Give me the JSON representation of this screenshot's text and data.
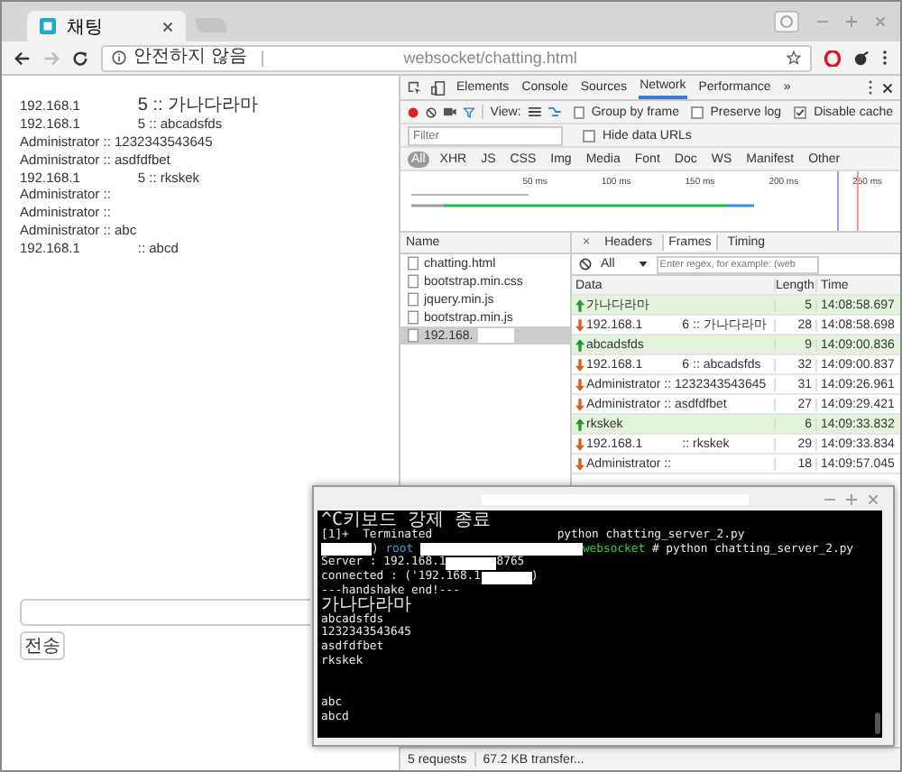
{
  "browser": {
    "tab": {
      "title": "채팅"
    },
    "address": {
      "security": "안전하지 않음",
      "url": "websocket/chatting.html"
    }
  },
  "chat": {
    "messages": [
      {
        "parts": [
          "192.168.1",
          "5 :: 가나다라마"
        ]
      },
      {
        "parts": [
          "192.168.1",
          "5 :: abcadsfds"
        ]
      },
      {
        "parts": [
          "Administrator :: 1232343543645"
        ]
      },
      {
        "parts": [
          "Administrator :: asdfdfbet"
        ]
      },
      {
        "parts": [
          "192.168.1",
          "5 :: rkskek"
        ]
      },
      {
        "parts": [
          "Administrator ::"
        ]
      },
      {
        "parts": [
          "Administrator ::"
        ]
      },
      {
        "parts": [
          "Administrator :: abc"
        ]
      },
      {
        "parts": [
          "192.168.1",
          ":: abcd"
        ]
      }
    ],
    "send_button": "전송"
  },
  "devtools": {
    "tabs": [
      {
        "label": "Elements",
        "selected": false
      },
      {
        "label": "Console",
        "selected": false
      },
      {
        "label": "Sources",
        "selected": false
      },
      {
        "label": "Network",
        "selected": true
      },
      {
        "label": "Performance",
        "selected": false
      }
    ],
    "more": "»",
    "view_label": "View:",
    "options": [
      {
        "label": "Group by frame",
        "checked": false
      },
      {
        "label": "Preserve log",
        "checked": false
      },
      {
        "label": "Disable cache",
        "checked": true
      }
    ],
    "filter": {
      "placeholder": "Filter"
    },
    "hide_data_urls": {
      "label": "Hide data URLs",
      "checked": false
    },
    "types": [
      {
        "label": "All",
        "selected": true
      },
      {
        "label": "XHR",
        "selected": false
      },
      {
        "label": "JS",
        "selected": false
      },
      {
        "label": "CSS",
        "selected": false
      },
      {
        "label": "Img",
        "selected": false
      },
      {
        "label": "Media",
        "selected": false
      },
      {
        "label": "Font",
        "selected": false
      },
      {
        "label": "Doc",
        "selected": false
      },
      {
        "label": "WS",
        "selected": false
      },
      {
        "label": "Manifest",
        "selected": false
      },
      {
        "label": "Other",
        "selected": false
      }
    ],
    "timeline_ticks": [
      "50 ms",
      "100 ms",
      "150 ms",
      "200 ms",
      "250 ms"
    ],
    "name_header": "Name",
    "requests": [
      {
        "name": "chatting.html",
        "selected": false
      },
      {
        "name": "bootstrap.min.css",
        "selected": false
      },
      {
        "name": "jquery.min.js",
        "selected": false
      },
      {
        "name": "bootstrap.min.js",
        "selected": false
      },
      {
        "name": "192.168.",
        "selected": true
      }
    ],
    "detail_close": "×",
    "detail_tabs": [
      {
        "label": "Headers",
        "selected": false
      },
      {
        "label": "Frames",
        "selected": true
      },
      {
        "label": "Timing",
        "selected": false
      }
    ],
    "frame_filter": {
      "value": "All",
      "placeholder": "Enter regex, for example: (web"
    },
    "columns": [
      "Data",
      "Length",
      "Time"
    ],
    "frames": [
      {
        "kind": "send",
        "parts": [
          "가나다라마"
        ],
        "length": "5",
        "time": "14:08:58.697"
      },
      {
        "kind": "receive",
        "parts": [
          "192.168.1",
          "6 :: 가나다라마"
        ],
        "length": "28",
        "time": "14:08:58.698"
      },
      {
        "kind": "send",
        "parts": [
          "abcadsfds"
        ],
        "length": "9",
        "time": "14:09:00.836"
      },
      {
        "kind": "receive",
        "parts": [
          "192.168.1",
          "6 :: abcadsfds"
        ],
        "length": "32",
        "time": "14:09:00.837"
      },
      {
        "kind": "receive",
        "parts": [
          "Administrator :: 1232343543645"
        ],
        "length": "31",
        "time": "14:09:26.961"
      },
      {
        "kind": "receive",
        "parts": [
          "Administrator :: asdfdfbet"
        ],
        "length": "27",
        "time": "14:09:29.421"
      },
      {
        "kind": "send",
        "parts": [
          "rkskek"
        ],
        "length": "6",
        "time": "14:09:33.832"
      },
      {
        "kind": "receive",
        "parts": [
          "192.168.1",
          ":: rkskek"
        ],
        "length": "29",
        "time": "14:09:33.834"
      },
      {
        "kind": "receive",
        "parts": [
          "Administrator ::"
        ],
        "length": "18",
        "time": "14:09:57.045"
      }
    ],
    "status": [
      "5 requests",
      "67.2 KB transfer..."
    ]
  },
  "terminal": {
    "lines": [
      {
        "kind": "output",
        "segments": [
          {
            "kind": "text",
            "text": "^C키보드 강제 종료"
          }
        ]
      },
      {
        "kind": "output",
        "segments": [
          {
            "kind": "text",
            "text": "[1]+  Terminated                  python chatting_server_2.py"
          }
        ]
      },
      {
        "kind": "output",
        "segments": [
          {
            "kind": "redacted"
          },
          {
            "kind": "text",
            "text": ")"
          },
          {
            "kind": "prompt",
            "text": " root "
          },
          {
            "kind": "redacted"
          },
          {
            "kind": "path",
            "text": "websocket"
          },
          {
            "kind": "text",
            "text": " # python chatting_server_2.py"
          }
        ]
      },
      {
        "kind": "output",
        "segments": [
          {
            "kind": "text",
            "text": "Server : 192.168.1"
          },
          {
            "kind": "redacted"
          },
          {
            "kind": "text",
            "text": "8765"
          }
        ]
      },
      {
        "kind": "output",
        "segments": [
          {
            "kind": "text",
            "text": "connected : ('192.168.1"
          },
          {
            "kind": "redacted"
          },
          {
            "kind": "text",
            "text": ")"
          }
        ]
      },
      {
        "kind": "output",
        "segments": [
          {
            "kind": "text",
            "text": "---handshake end!---"
          }
        ]
      },
      {
        "kind": "output",
        "segments": [
          {
            "kind": "text",
            "text": "가나다라마"
          }
        ]
      },
      {
        "kind": "output",
        "segments": [
          {
            "kind": "text",
            "text": "abcadsfds"
          }
        ]
      },
      {
        "kind": "output",
        "segments": [
          {
            "kind": "text",
            "text": "1232343543645"
          }
        ]
      },
      {
        "kind": "output",
        "segments": [
          {
            "kind": "text",
            "text": "asdfdfbet"
          }
        ]
      },
      {
        "kind": "output",
        "segments": [
          {
            "kind": "text",
            "text": "rkskek"
          }
        ]
      },
      {
        "kind": "blank"
      },
      {
        "kind": "blank"
      },
      {
        "kind": "output",
        "segments": [
          {
            "kind": "text",
            "text": "abc"
          }
        ]
      },
      {
        "kind": "output",
        "segments": [
          {
            "kind": "text",
            "text": "abcd"
          }
        ]
      }
    ]
  }
}
